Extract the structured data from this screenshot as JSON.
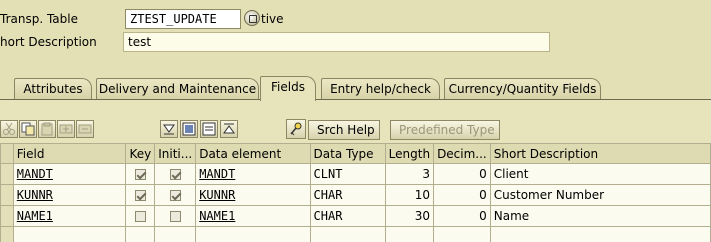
{
  "header": {
    "table_label": "Transp. Table",
    "table_value": "ZTEST_UPDATE",
    "status_text": "tive",
    "short_desc_label": "hort Description",
    "short_desc_value": "test"
  },
  "tabs": [
    {
      "label": "Attributes",
      "active": false
    },
    {
      "label": "Delivery and Maintenance",
      "active": false
    },
    {
      "label": "Fields",
      "active": true
    },
    {
      "label": "Entry help/check",
      "active": false
    },
    {
      "label": "Currency/Quantity Fields",
      "active": false
    }
  ],
  "toolbar": {
    "srch_help_label": "Srch Help",
    "predefined_type_label": "Predefined Type"
  },
  "table": {
    "columns": [
      "Field",
      "Key",
      "Initi...",
      "Data element",
      "Data Type",
      "Length",
      "Decim...",
      "Short Description"
    ],
    "rows": [
      {
        "field": "MANDT",
        "key": true,
        "initial": true,
        "data_element": "MANDT",
        "data_type": "CLNT",
        "length": "3",
        "decimals": "0",
        "description": "Client"
      },
      {
        "field": "KUNNR",
        "key": true,
        "initial": true,
        "data_element": "KUNNR",
        "data_type": "CHAR",
        "length": "10",
        "decimals": "0",
        "description": "Customer Number"
      },
      {
        "field": "NAME1",
        "key": false,
        "initial": false,
        "data_element": "NAME1",
        "data_type": "CHAR",
        "length": "30",
        "decimals": "0",
        "description": "Name"
      }
    ]
  },
  "colors": {
    "background": "#e4e0b6",
    "header_cell": "#dedab2",
    "cell": "#fbfbef"
  }
}
